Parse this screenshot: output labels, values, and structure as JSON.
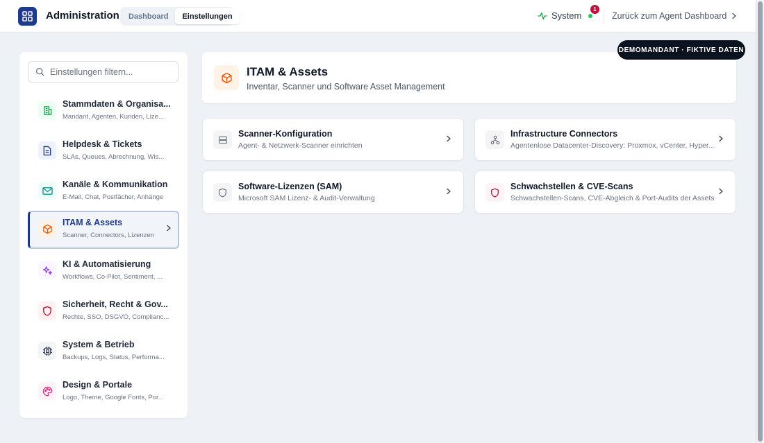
{
  "header": {
    "app_title": "Administration",
    "tabs": [
      {
        "label": "Dashboard",
        "active": false
      },
      {
        "label": "Einstellungen",
        "active": true
      }
    ],
    "system_label": "System",
    "notification_count": "1",
    "back_link": "Zurück zum Agent Dashboard"
  },
  "sidebar": {
    "filter_placeholder": "Einstellungen filtern...",
    "items": [
      {
        "title": "Stammdaten & Organisa...",
        "subtitle": "Mandant, Agenten, Kunden, Lize...",
        "icon": "building-icon",
        "color": "#16a34a",
        "bg": "#ecfdf3"
      },
      {
        "title": "Helpdesk & Tickets",
        "subtitle": "SLAs, Queues, Abrechnung, Wis...",
        "icon": "document-icon",
        "color": "#1e3a8a",
        "bg": "#eef2ff"
      },
      {
        "title": "Kanäle & Kommunikation",
        "subtitle": "E-Mail, Chat, Postfächer, Anhänge",
        "icon": "mail-icon",
        "color": "#0d9488",
        "bg": "#ecfdfa"
      },
      {
        "title": "ITAM & Assets",
        "subtitle": "Scanner, Connectors, Lizenzen",
        "icon": "box-icon",
        "color": "#ea580c",
        "bg": "#fff2e6"
      },
      {
        "title": "KI & Automatisierung",
        "subtitle": "Workflows, Co-Pilot, Sentiment, ...",
        "icon": "sparkles-icon",
        "color": "#9333ea",
        "bg": "#faf5ff"
      },
      {
        "title": "Sicherheit, Recht & Gov...",
        "subtitle": "Rechte, SSO, DSGVO, Complianc...",
        "icon": "shield-icon",
        "color": "#be123c",
        "bg": "#fff1f2"
      },
      {
        "title": "System & Betrieb",
        "subtitle": "Backups, Logs, Status, Performa...",
        "icon": "cpu-icon",
        "color": "#374151",
        "bg": "#f3f4f6"
      },
      {
        "title": "Design & Portale",
        "subtitle": "Logo, Theme, Google Fonts, Por...",
        "icon": "palette-icon",
        "color": "#db2777",
        "bg": "#fdf2f8"
      }
    ]
  },
  "demo_badge": "DEMOMANDANT · FIKTIVE DATEN",
  "main": {
    "title": "ITAM & Assets",
    "subtitle": "Inventar, Scanner und Software Asset Management",
    "cards": [
      {
        "title": "Scanner-Konfiguration",
        "desc": "Agent- & Netzwerk-Scanner einrichten",
        "icon": "server-icon"
      },
      {
        "title": "Infrastructure Connectors",
        "desc": "Agentenlose Datacenter-Discovery: Proxmox, vCenter, Hyper...",
        "icon": "network-icon"
      },
      {
        "title": "Software-Lizenzen (SAM)",
        "desc": "Microsoft SAM Lizenz- & Audit-Verwaltung",
        "icon": "shield-icon"
      },
      {
        "title": "Schwachstellen & CVE-Scans",
        "desc": "Schwachstellen-Scans, CVE-Abgleich & Port-Audits der Assets",
        "icon": "shield-alert-icon"
      }
    ]
  }
}
